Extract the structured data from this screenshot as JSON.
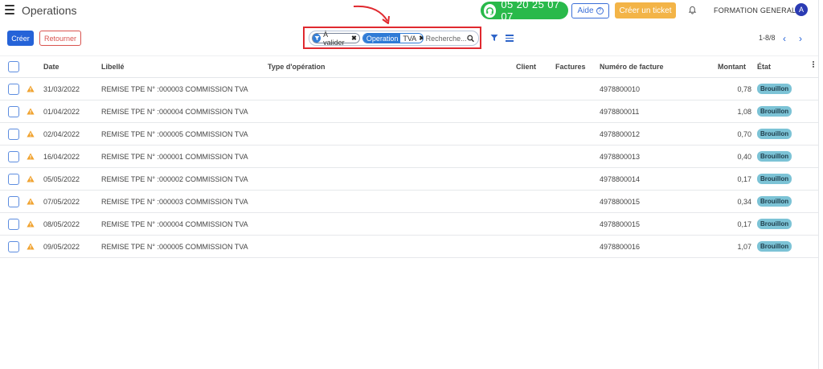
{
  "header": {
    "title": "Operations",
    "phone": "05 20 25 07 07",
    "help_label": "Aide",
    "help_icon_glyph": "?",
    "ticket_label": "Créer un ticket",
    "company": "FORMATION GENERALE",
    "avatar_initial": "A"
  },
  "toolbar": {
    "create_label": "Créer",
    "return_label": "Retourner"
  },
  "search": {
    "facets": [
      {
        "type": "filter",
        "value": "À valider"
      },
      {
        "type": "groupby",
        "label": "Operation",
        "value": "TVA"
      }
    ],
    "remove_glyph": "✖",
    "placeholder": "Recherche..."
  },
  "pager": {
    "range": "1-8/8",
    "prev_glyph": "‹",
    "next_glyph": "›"
  },
  "table": {
    "columns": {
      "date": "Date",
      "libelle": "Libellé",
      "type": "Type d'opération",
      "client": "Client",
      "factures": "Factures",
      "numero": "Numéro de facture",
      "montant": "Montant",
      "etat": "État"
    },
    "rows": [
      {
        "date": "31/03/2022",
        "libelle": "REMISE TPE N° :000003 COMMISSION TVA",
        "type": "",
        "client": "",
        "factures": "",
        "numero": "4978800010",
        "montant": "0,78",
        "etat": "Brouillon"
      },
      {
        "date": "01/04/2022",
        "libelle": "REMISE TPE N° :000004 COMMISSION TVA",
        "type": "",
        "client": "",
        "factures": "",
        "numero": "4978800011",
        "montant": "1,08",
        "etat": "Brouillon"
      },
      {
        "date": "02/04/2022",
        "libelle": "REMISE TPE N° :000005 COMMISSION TVA",
        "type": "",
        "client": "",
        "factures": "",
        "numero": "4978800012",
        "montant": "0,70",
        "etat": "Brouillon"
      },
      {
        "date": "16/04/2022",
        "libelle": "REMISE TPE N° :000001 COMMISSION TVA",
        "type": "",
        "client": "",
        "factures": "",
        "numero": "4978800013",
        "montant": "0,40",
        "etat": "Brouillon"
      },
      {
        "date": "05/05/2022",
        "libelle": "REMISE TPE N° :000002 COMMISSION TVA",
        "type": "",
        "client": "",
        "factures": "",
        "numero": "4978800014",
        "montant": "0,17",
        "etat": "Brouillon"
      },
      {
        "date": "07/05/2022",
        "libelle": "REMISE TPE N° :000003 COMMISSION TVA",
        "type": "",
        "client": "",
        "factures": "",
        "numero": "4978800015",
        "montant": "0,34",
        "etat": "Brouillon"
      },
      {
        "date": "08/05/2022",
        "libelle": "REMISE TPE N° :000004 COMMISSION TVA",
        "type": "",
        "client": "",
        "factures": "",
        "numero": "4978800015",
        "montant": "0,17",
        "etat": "Brouillon"
      },
      {
        "date": "09/05/2022",
        "libelle": "REMISE TPE N° :000005 COMMISSION TVA",
        "type": "",
        "client": "",
        "factures": "",
        "numero": "4978800016",
        "montant": "1,07",
        "etat": "Brouillon"
      }
    ]
  },
  "colors": {
    "primary": "#2563d8",
    "phone_green": "#29b94a",
    "ticket_orange": "#f3b447",
    "highlight_red": "#e0292f",
    "badge_blue": "#7cc3d6",
    "warning_orange": "#f0a22e"
  },
  "icons": [
    "menu-icon",
    "headset-icon",
    "help-icon",
    "bell-icon",
    "filter-icon",
    "search-icon",
    "groupby-icon",
    "warning-icon",
    "kebab-icon",
    "annotation-arrow"
  ]
}
